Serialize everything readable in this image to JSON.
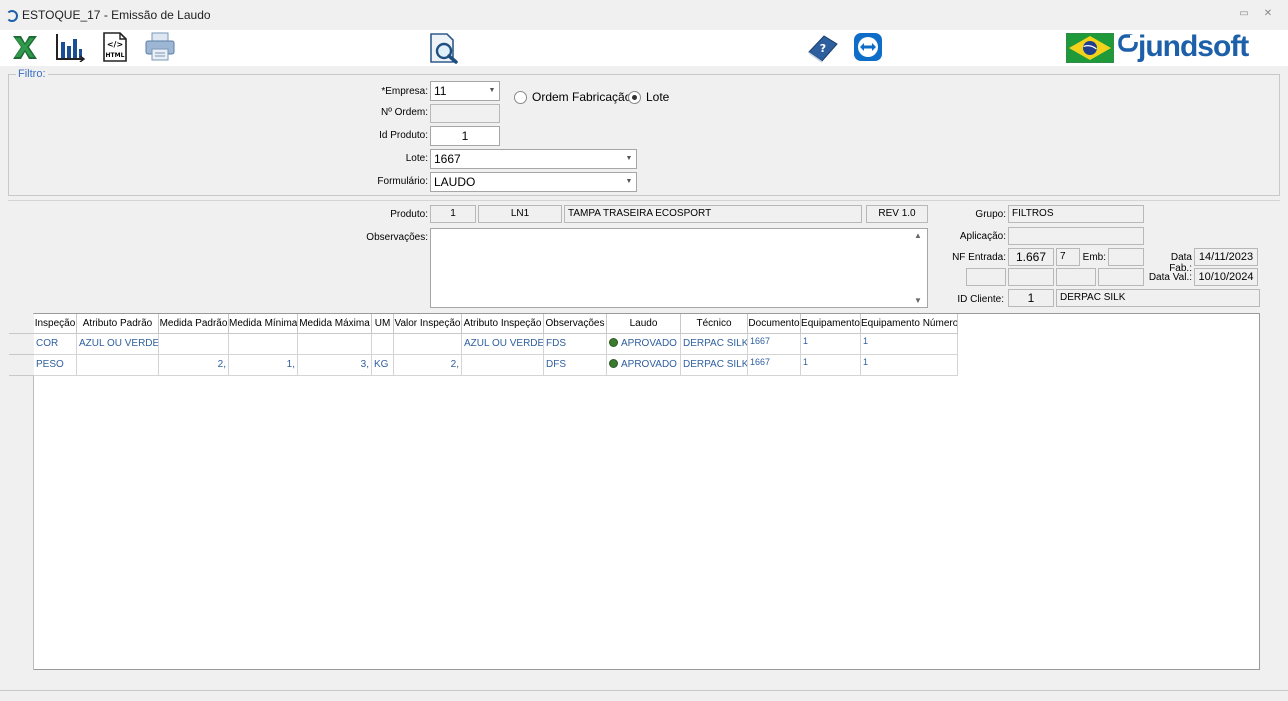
{
  "window": {
    "title": "ESTOQUE_17 - Emissão de Laudo",
    "minimize": "▭",
    "close": "✕"
  },
  "toolbar": {
    "excel_icon": "excel-icon",
    "chart_icon": "chart-icon",
    "html_icon": "html-icon",
    "html_text": "</>",
    "html_caption": "HTML",
    "print_icon": "printer-icon",
    "search_doc_icon": "search-document-icon",
    "help_book_icon": "help-book-icon",
    "teamviewer_icon": "teamviewer-icon",
    "flag_icon": "brazil-flag-icon",
    "logo_text": "jundsoft"
  },
  "filtro": {
    "legend": "Filtro:",
    "empresa_label": "*Empresa:",
    "empresa_value": "11",
    "ordem_label": "Nº Ordem:",
    "ordem_value": "",
    "id_produto_label": "Id Produto:",
    "id_produto_value": "1",
    "lote_label": "Lote:",
    "lote_value": "1667",
    "formulario_label": "Formulário:",
    "formulario_value": "LAUDO",
    "radio_ordem_label": "Ordem Fabricação",
    "radio_lote_label": "Lote",
    "selected": "Lote"
  },
  "produto": {
    "label": "Produto:",
    "id": "1",
    "code": "LN1",
    "name": "TAMPA TRASEIRA ECOSPORT",
    "rev": "REV 1.0",
    "obs_label": "Observações:",
    "obs_value": "",
    "grupo_label": "Grupo:",
    "grupo_value": "FILTROS",
    "aplicacao_label": "Aplicação:",
    "aplicacao_value": "",
    "nf_label": "NF Entrada:",
    "nf_value": "1.667",
    "nf_seq": "7",
    "emb_label": "Emb:",
    "emb_value": "",
    "data_fab_label": "Data Fab.:",
    "data_fab_value": "14/11/2023",
    "data_val_label": "Data Val.:",
    "data_val_value": "10/10/2024",
    "id_cliente_label": "ID Cliente:",
    "id_cliente_value": "1",
    "cliente_nome": "DERPAC SILK"
  },
  "grid": {
    "columns": [
      "Inspeção",
      "Atributo Padrão",
      "Medida Padrão",
      "Medida Mínima",
      "Medida Máxima",
      "UM",
      "Valor Inspeção",
      "Atributo Inspeção",
      "Observações",
      "Laudo",
      "Técnico",
      "Documento",
      "Equipamento",
      "Equipamento Número"
    ],
    "rows": [
      [
        "COR",
        "AZUL OU VERDE",
        "",
        "",
        "",
        "",
        "",
        "AZUL OU VERDE",
        "FDS",
        "APROVADO",
        "DERPAC SILK",
        "1667",
        "1",
        "1"
      ],
      [
        "PESO",
        "",
        "2,",
        "1,",
        "3,",
        "KG",
        "2,",
        "",
        "DFS",
        "APROVADO",
        "DERPAC SILK",
        "1667",
        "1",
        "1"
      ]
    ],
    "status_color": "#3b7a2f"
  }
}
